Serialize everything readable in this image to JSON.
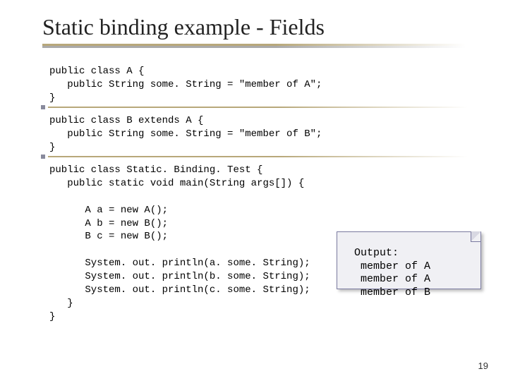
{
  "title": "Static binding example - Fields",
  "code_class_a": "public class A {\n   public String some. String = \"member of A\";\n}",
  "code_class_b": "public class B extends A {\n   public String some. String = \"member of B\";\n}",
  "code_main": "public class Static. Binding. Test {\n   public static void main(String args[]) {\n\n      A a = new A();\n      A b = new B();\n      B c = new B();\n\n      System. out. println(a. some. String);\n      System. out. println(b. some. String);\n      System. out. println(c. some. String);\n   }\n}",
  "output": {
    "heading": "Output:",
    "lines": [
      "member of A",
      "member of A",
      "member of B"
    ]
  },
  "page_number": "19"
}
